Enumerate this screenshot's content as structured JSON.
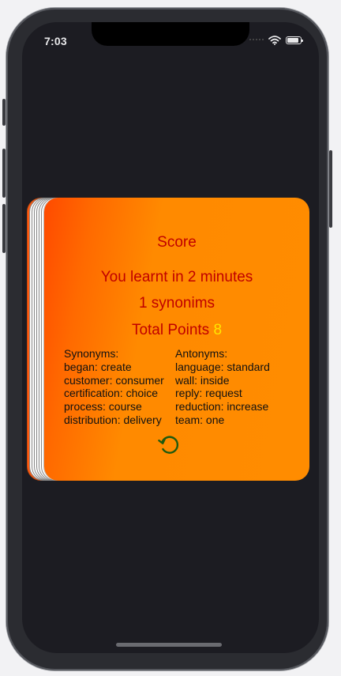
{
  "status_bar": {
    "time": "7:03",
    "icons": [
      "wifi-icon",
      "battery-icon"
    ],
    "battery_level": 0.85
  },
  "card": {
    "title": "Score",
    "learnt_text": "You learnt in 2 minutes",
    "synonyms_count_text": "1 synonims",
    "points_label": "Total Points",
    "points_value": "8",
    "synonyms": {
      "header": "Synonyms:",
      "items": [
        "began: create",
        "customer: consumer",
        "certification: choice",
        "process: course",
        "distribution: delivery"
      ]
    },
    "antonyms": {
      "header": "Antonyms:",
      "items": [
        "language: standard",
        "wall: inside",
        "reply: request",
        "reduction: increase",
        "team: one"
      ]
    },
    "replay_icon": "replay-icon"
  },
  "colors": {
    "screen_bg": "#1c1c22",
    "card_gradient_start": "#ff4a00",
    "card_gradient_end": "#ff8c00",
    "title_text": "#c00000",
    "points_value": "#ffe600",
    "replay_icon": "#1f5a0f"
  }
}
